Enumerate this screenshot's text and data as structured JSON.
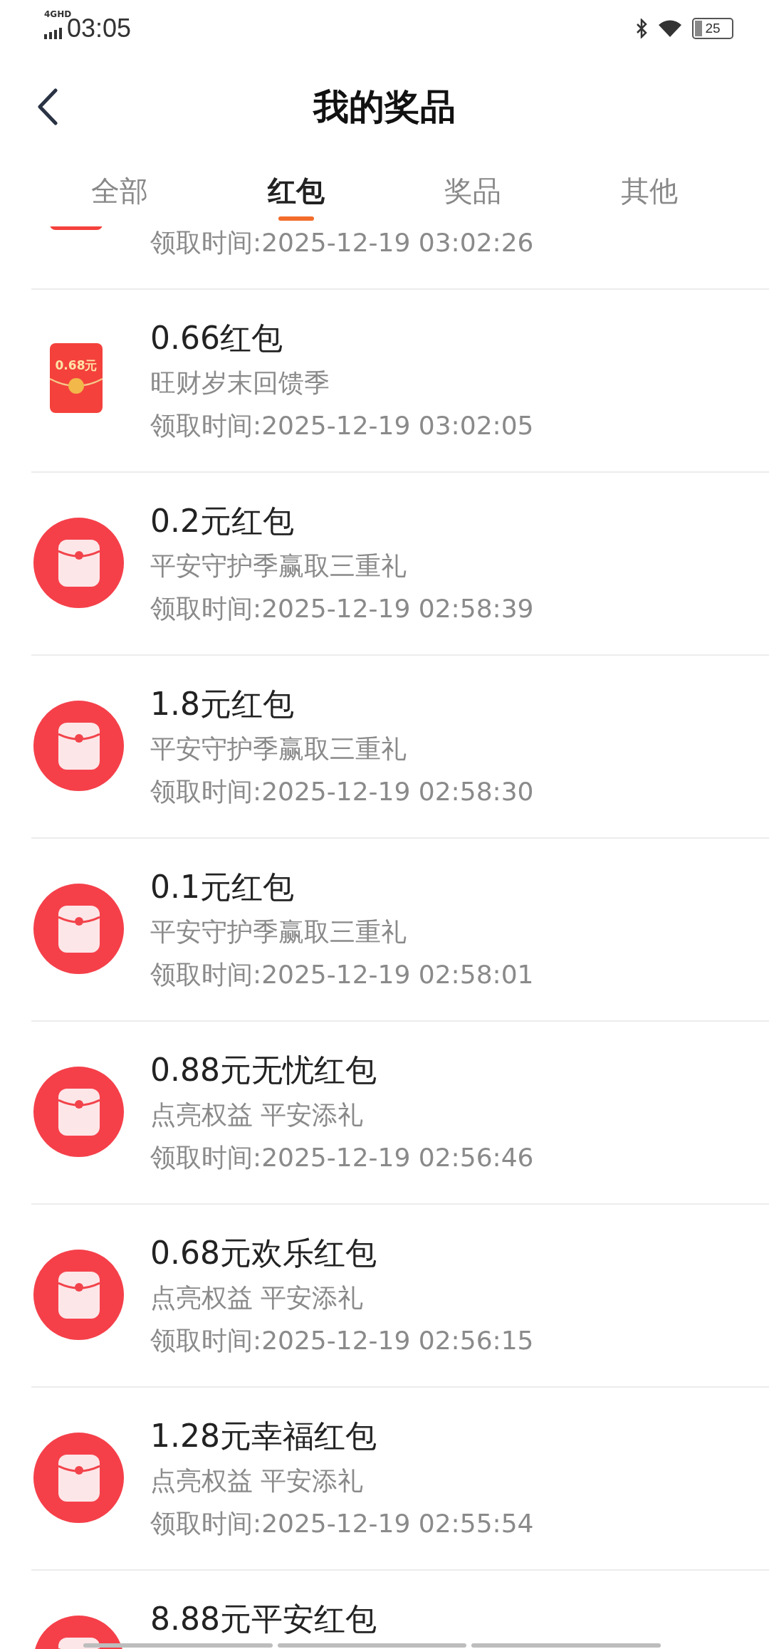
{
  "status_bar": {
    "network": "4GHD",
    "time": "03:05",
    "battery": "25"
  },
  "header": {
    "title": "我的奖品"
  },
  "tabs": [
    {
      "label": "全部",
      "selected": false
    },
    {
      "label": "红包",
      "selected": true
    },
    {
      "label": "奖品",
      "selected": false
    },
    {
      "label": "其他",
      "selected": false
    }
  ],
  "prizes": [
    {
      "kind": "packet",
      "time": "领取时间:2025-12-19 03:02:26"
    },
    {
      "kind": "packet",
      "icon_text": "0.68元",
      "title": "0.66红包",
      "subtitle": "旺财岁末回馈季",
      "time": "领取时间:2025-12-19 03:02:05"
    },
    {
      "kind": "circle",
      "title": "0.2元红包",
      "subtitle": "平安守护季赢取三重礼",
      "time": "领取时间:2025-12-19 02:58:39"
    },
    {
      "kind": "circle",
      "title": "1.8元红包",
      "subtitle": "平安守护季赢取三重礼",
      "time": "领取时间:2025-12-19 02:58:30"
    },
    {
      "kind": "circle",
      "title": "0.1元红包",
      "subtitle": "平安守护季赢取三重礼",
      "time": "领取时间:2025-12-19 02:58:01"
    },
    {
      "kind": "circle",
      "title": "0.88元无忧红包",
      "subtitle": "点亮权益 平安添礼",
      "time": "领取时间:2025-12-19 02:56:46"
    },
    {
      "kind": "circle",
      "title": "0.68元欢乐红包",
      "subtitle": "点亮权益 平安添礼",
      "time": "领取时间:2025-12-19 02:56:15"
    },
    {
      "kind": "circle",
      "title": "1.28元幸福红包",
      "subtitle": "点亮权益 平安添礼",
      "time": "领取时间:2025-12-19 02:55:54"
    },
    {
      "kind": "circle",
      "title": "8.88元平安红包"
    }
  ]
}
